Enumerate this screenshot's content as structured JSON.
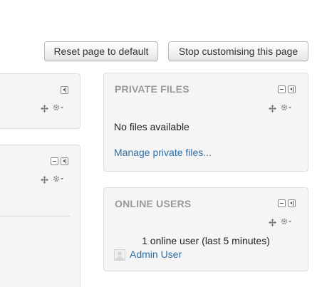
{
  "toolbar": {
    "reset_label": "Reset page to default",
    "stop_label": "Stop customising this page"
  },
  "blocks": {
    "private_files": {
      "title": "PRIVATE FILES",
      "empty_text": "No files available",
      "manage_link": "Manage private files..."
    },
    "online_users": {
      "title": "ONLINE USERS",
      "summary": "1 online user (last 5 minutes)",
      "users": [
        {
          "name": "Admin User"
        }
      ]
    }
  },
  "icons": {
    "minimize": "minus-square-icon",
    "dock": "dock-icon",
    "move": "move-icon",
    "actions": "gear-icon"
  },
  "colors": {
    "block_title": "#999999",
    "link": "#2f6ea5",
    "block_bg": "#f5f5f5"
  }
}
